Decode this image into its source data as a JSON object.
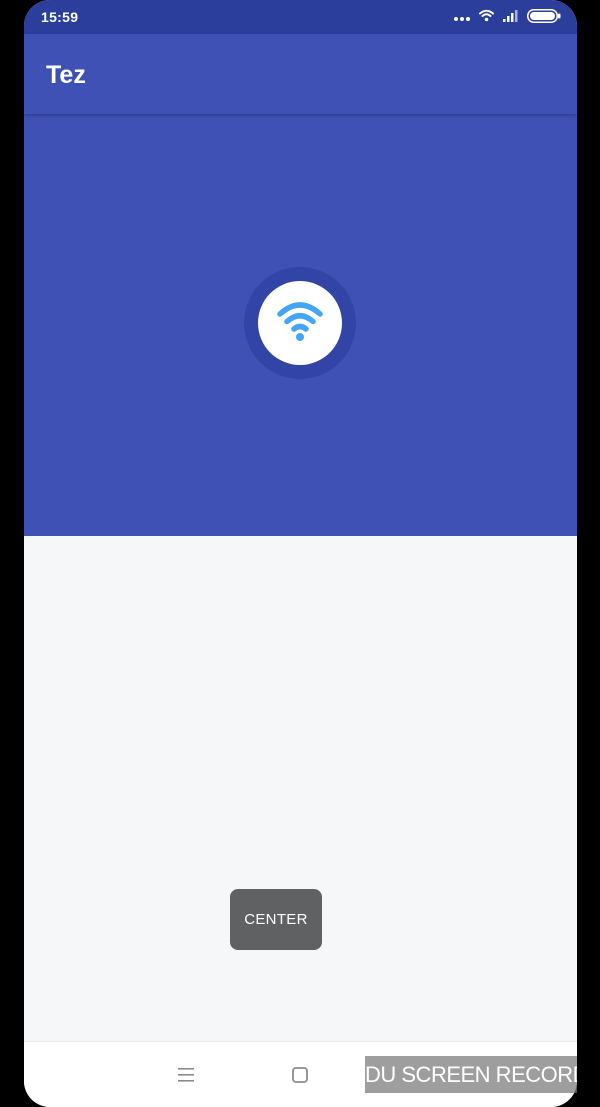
{
  "status_bar": {
    "time": "15:59",
    "icons": [
      "more-dots-icon",
      "wifi-icon",
      "signal-icon",
      "battery-icon"
    ]
  },
  "app_bar": {
    "title": "Tez"
  },
  "hero": {
    "icon": "wifi-icon",
    "icon_color": "#42a5f5"
  },
  "toast": {
    "text": "CENTER"
  },
  "nav_bar": {
    "icons": [
      "menu-icon",
      "home-square-icon"
    ]
  },
  "watermark": {
    "text": "DU SCREEN RECORDER"
  },
  "colors": {
    "primary": "#3f51b5",
    "primary_dark": "#2c3e9c",
    "background": "#f5f7f8",
    "toast": "#5f6163"
  }
}
